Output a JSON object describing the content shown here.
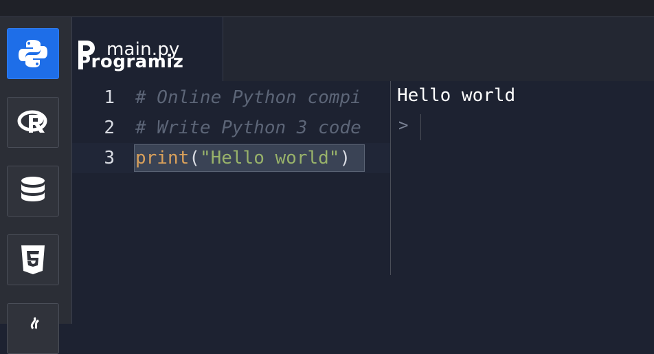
{
  "sidebar": {
    "items": [
      {
        "name": "python",
        "icon": "python-icon",
        "active": true
      },
      {
        "name": "r",
        "icon": "r-icon",
        "active": false
      },
      {
        "name": "sql",
        "icon": "database-icon",
        "active": false
      },
      {
        "name": "html",
        "icon": "html5-icon",
        "active": false
      },
      {
        "name": "java",
        "icon": "java-icon",
        "active": false
      }
    ]
  },
  "brand": {
    "logo_text": "Programiz"
  },
  "tab": {
    "filename": "main.py"
  },
  "editor": {
    "lines": [
      {
        "number": "1",
        "text": "# Online Python compi"
      },
      {
        "number": "2",
        "text": "# Write Python 3 code"
      },
      {
        "number": "3",
        "fn": "print",
        "open": "(",
        "string": "\"Hello world\"",
        "close": ")"
      }
    ]
  },
  "output": {
    "text": "Hello world",
    "prompt": ">"
  },
  "colors": {
    "accent": "#1e6ee8",
    "background": "#1d2231",
    "sidebar": "#2b2e36",
    "comment": "#5c6577",
    "function": "#d9a05b",
    "string": "#98b26a"
  }
}
